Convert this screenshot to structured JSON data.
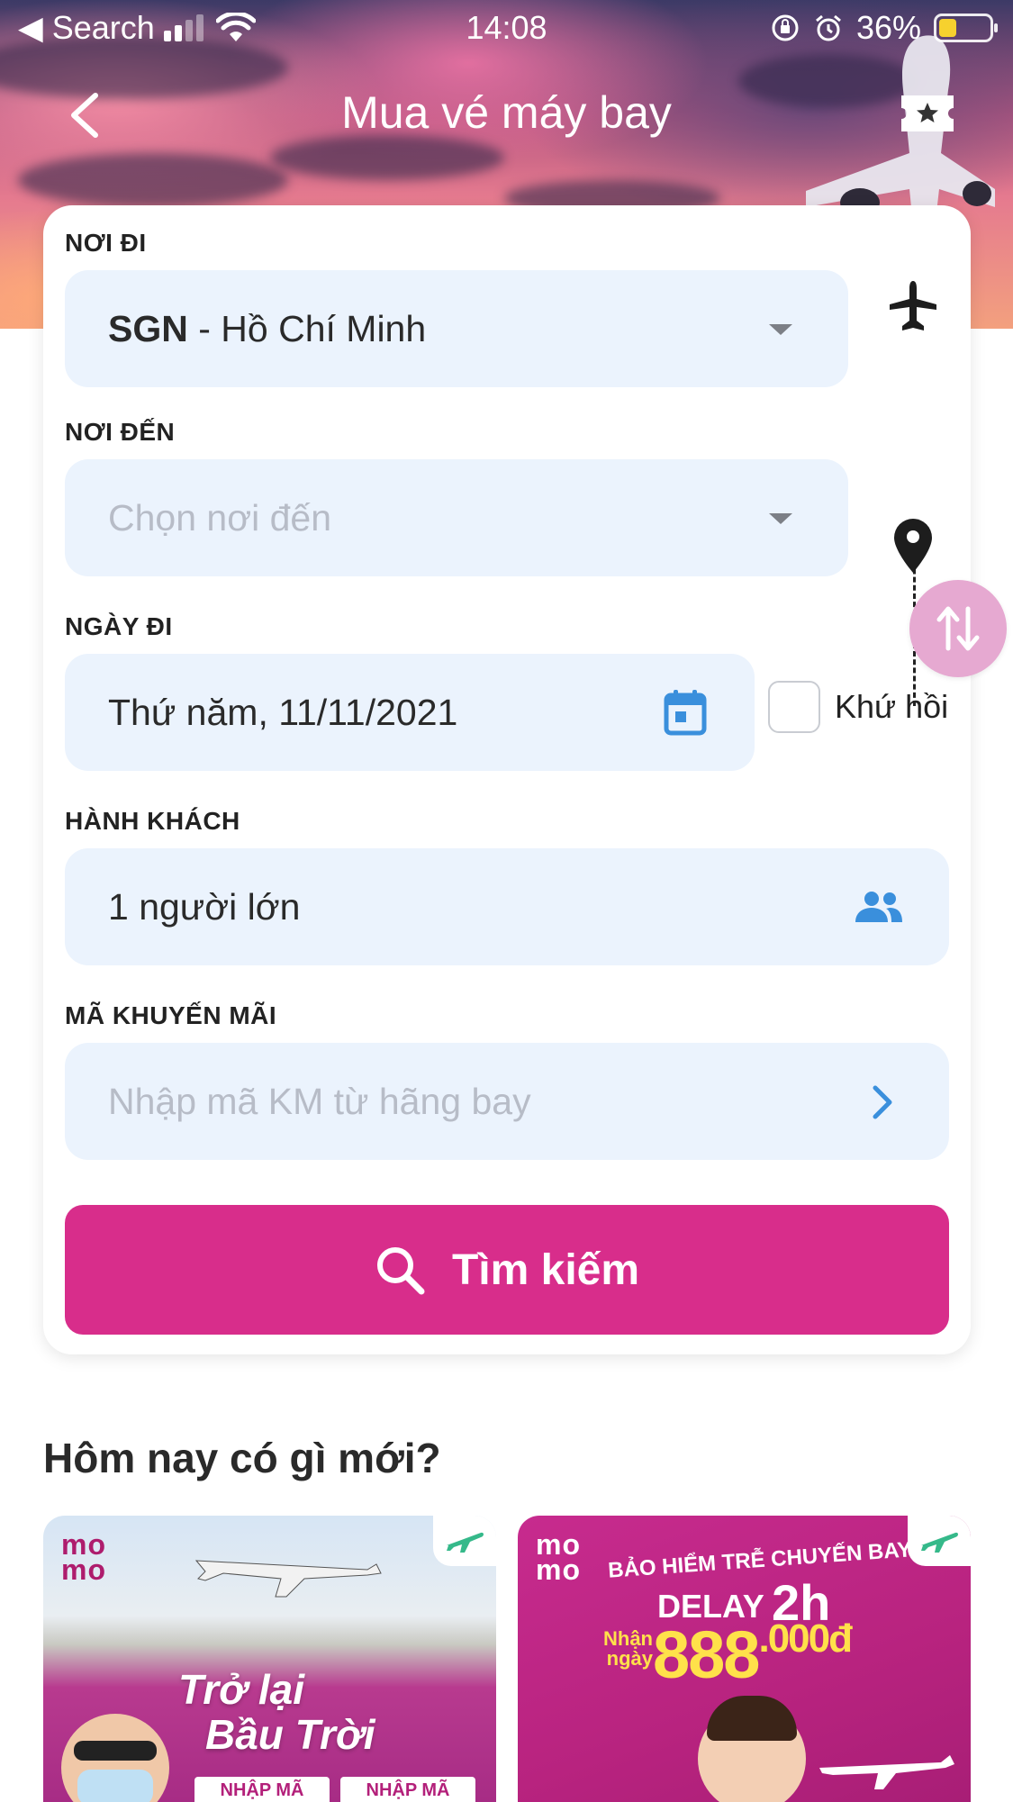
{
  "status_bar": {
    "back_app": "◀ Search",
    "time": "14:08",
    "battery": "36%",
    "battery_level": 0.36
  },
  "nav": {
    "title": "Mua vé máy bay"
  },
  "form": {
    "origin": {
      "label": "NƠI ĐI",
      "code": "SGN",
      "name": " - Hồ Chí Minh"
    },
    "destination": {
      "label": "NƠI ĐẾN",
      "placeholder": "Chọn nơi đến"
    },
    "departure": {
      "label": "NGÀY ĐI",
      "value": "Thứ năm, 11/11/2021"
    },
    "round_trip": {
      "label": "Khứ hồi",
      "checked": false
    },
    "passengers": {
      "label": "HÀNH KHÁCH",
      "value": "1 người lớn"
    },
    "promo": {
      "label": "MÃ KHUYẾN MÃI",
      "placeholder": "Nhập mã KM từ hãng bay"
    },
    "search_label": "Tìm kiếm"
  },
  "news": {
    "title": "Hôm nay có gì mới?",
    "banners": [
      {
        "logo": "mo mo",
        "title_line1": "Trở lại",
        "title_line2": "Bầu Trời",
        "code_a": "NHẬP MÃ",
        "code_b": "NHẬP MÃ"
      },
      {
        "logo": "mo mo",
        "headline": "BẢO HIỂM TRỄ CHUYẾN BAY",
        "delay": "DELAY",
        "hours": "2h",
        "receive": "Nhận ngày",
        "amount_main": "888",
        "amount_suffix": ".000đ"
      }
    ]
  },
  "colors": {
    "primary": "#d82d8b",
    "field_bg": "#ebf3fd",
    "icon_blue": "#3a8fdc",
    "swap_bg": "#e6a9d1"
  }
}
